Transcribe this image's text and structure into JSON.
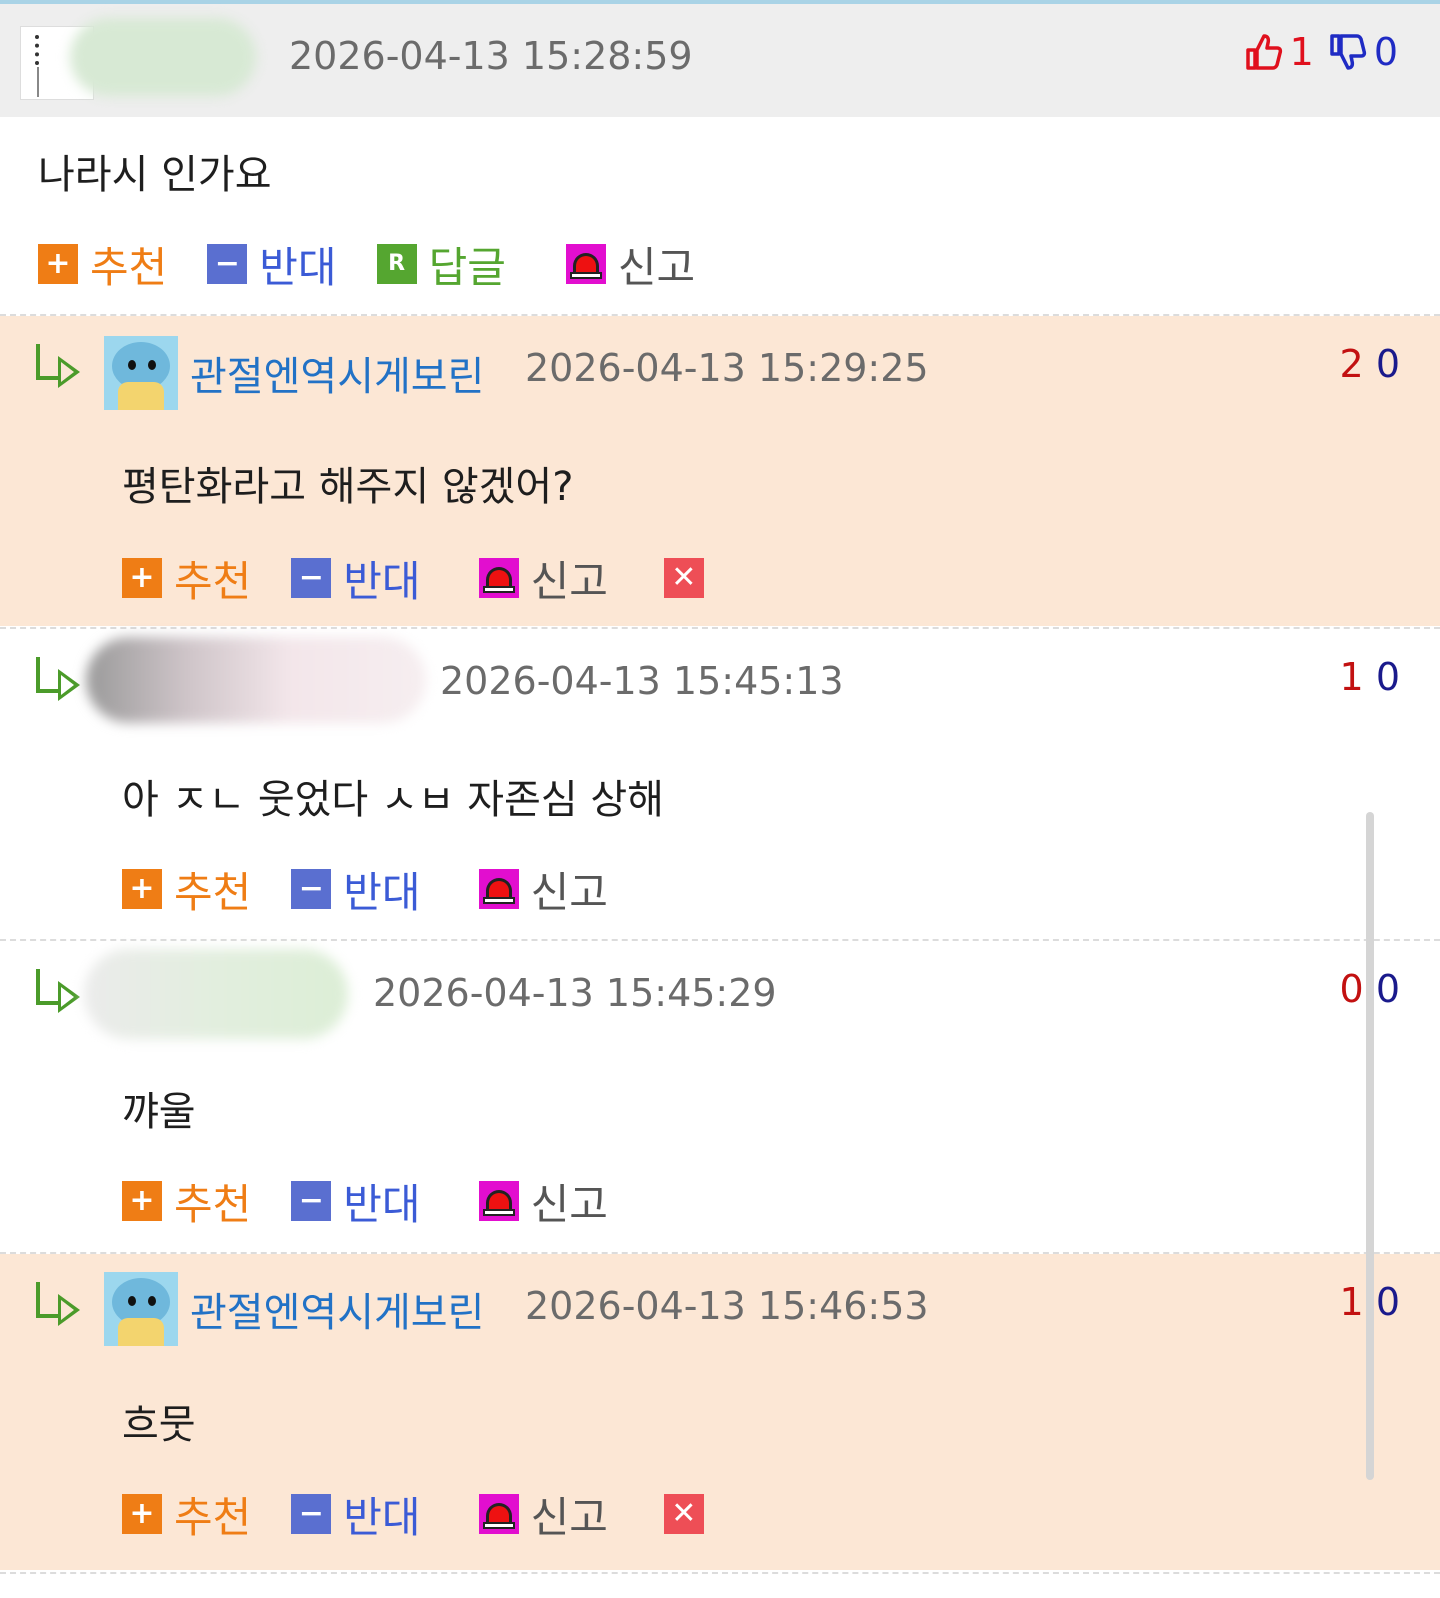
{
  "main_comment": {
    "timestamp": "2026-04-13 15:28:59",
    "up_votes": "1",
    "down_votes": "0",
    "text": "나라시 인가요",
    "actions": {
      "recommend": "추천",
      "oppose": "반대",
      "reply": "답글",
      "report": "신고"
    }
  },
  "replies": [
    {
      "nickname": "관절엔역시게보린",
      "timestamp": "2026-04-13 15:29:25",
      "up": "2",
      "down": "0",
      "text": "평탄화라고 해주지 않겠어?",
      "actions": {
        "recommend": "추천",
        "oppose": "반대",
        "report": "신고"
      }
    },
    {
      "nickname": "",
      "timestamp": "2026-04-13 15:45:13",
      "up": "1",
      "down": "0",
      "text": "아 ㅈㄴ 웃었다 ㅅㅂ 자존심 상해",
      "actions": {
        "recommend": "추천",
        "oppose": "반대",
        "report": "신고"
      }
    },
    {
      "nickname": "",
      "timestamp": "2026-04-13 15:45:29",
      "up": "0",
      "down": "0",
      "text": "꺄울",
      "actions": {
        "recommend": "추천",
        "oppose": "반대",
        "report": "신고"
      }
    },
    {
      "nickname": "관절엔역시게보린",
      "timestamp": "2026-04-13 15:46:53",
      "up": "1",
      "down": "0",
      "text": "흐뭇",
      "actions": {
        "recommend": "추천",
        "oppose": "반대",
        "report": "신고"
      }
    }
  ],
  "icons": {
    "recommend": "plus-icon",
    "oppose": "minus-icon",
    "reply": "reply-r-icon",
    "report": "siren-icon",
    "delete": "delete-x-icon",
    "thumbs_up": "thumbs-up-icon",
    "thumbs_down": "thumbs-down-icon",
    "reply_arrow": "reply-arrow-icon",
    "delete_glyph": "✕"
  },
  "colors": {
    "peach_bg": "#fce7d5",
    "header_bg": "#eeeeee",
    "recommend": "#ef7d15",
    "oppose": "#5a6fd0",
    "reply": "#55a630",
    "report": "#e20ecf",
    "nickname": "#2272c6"
  }
}
